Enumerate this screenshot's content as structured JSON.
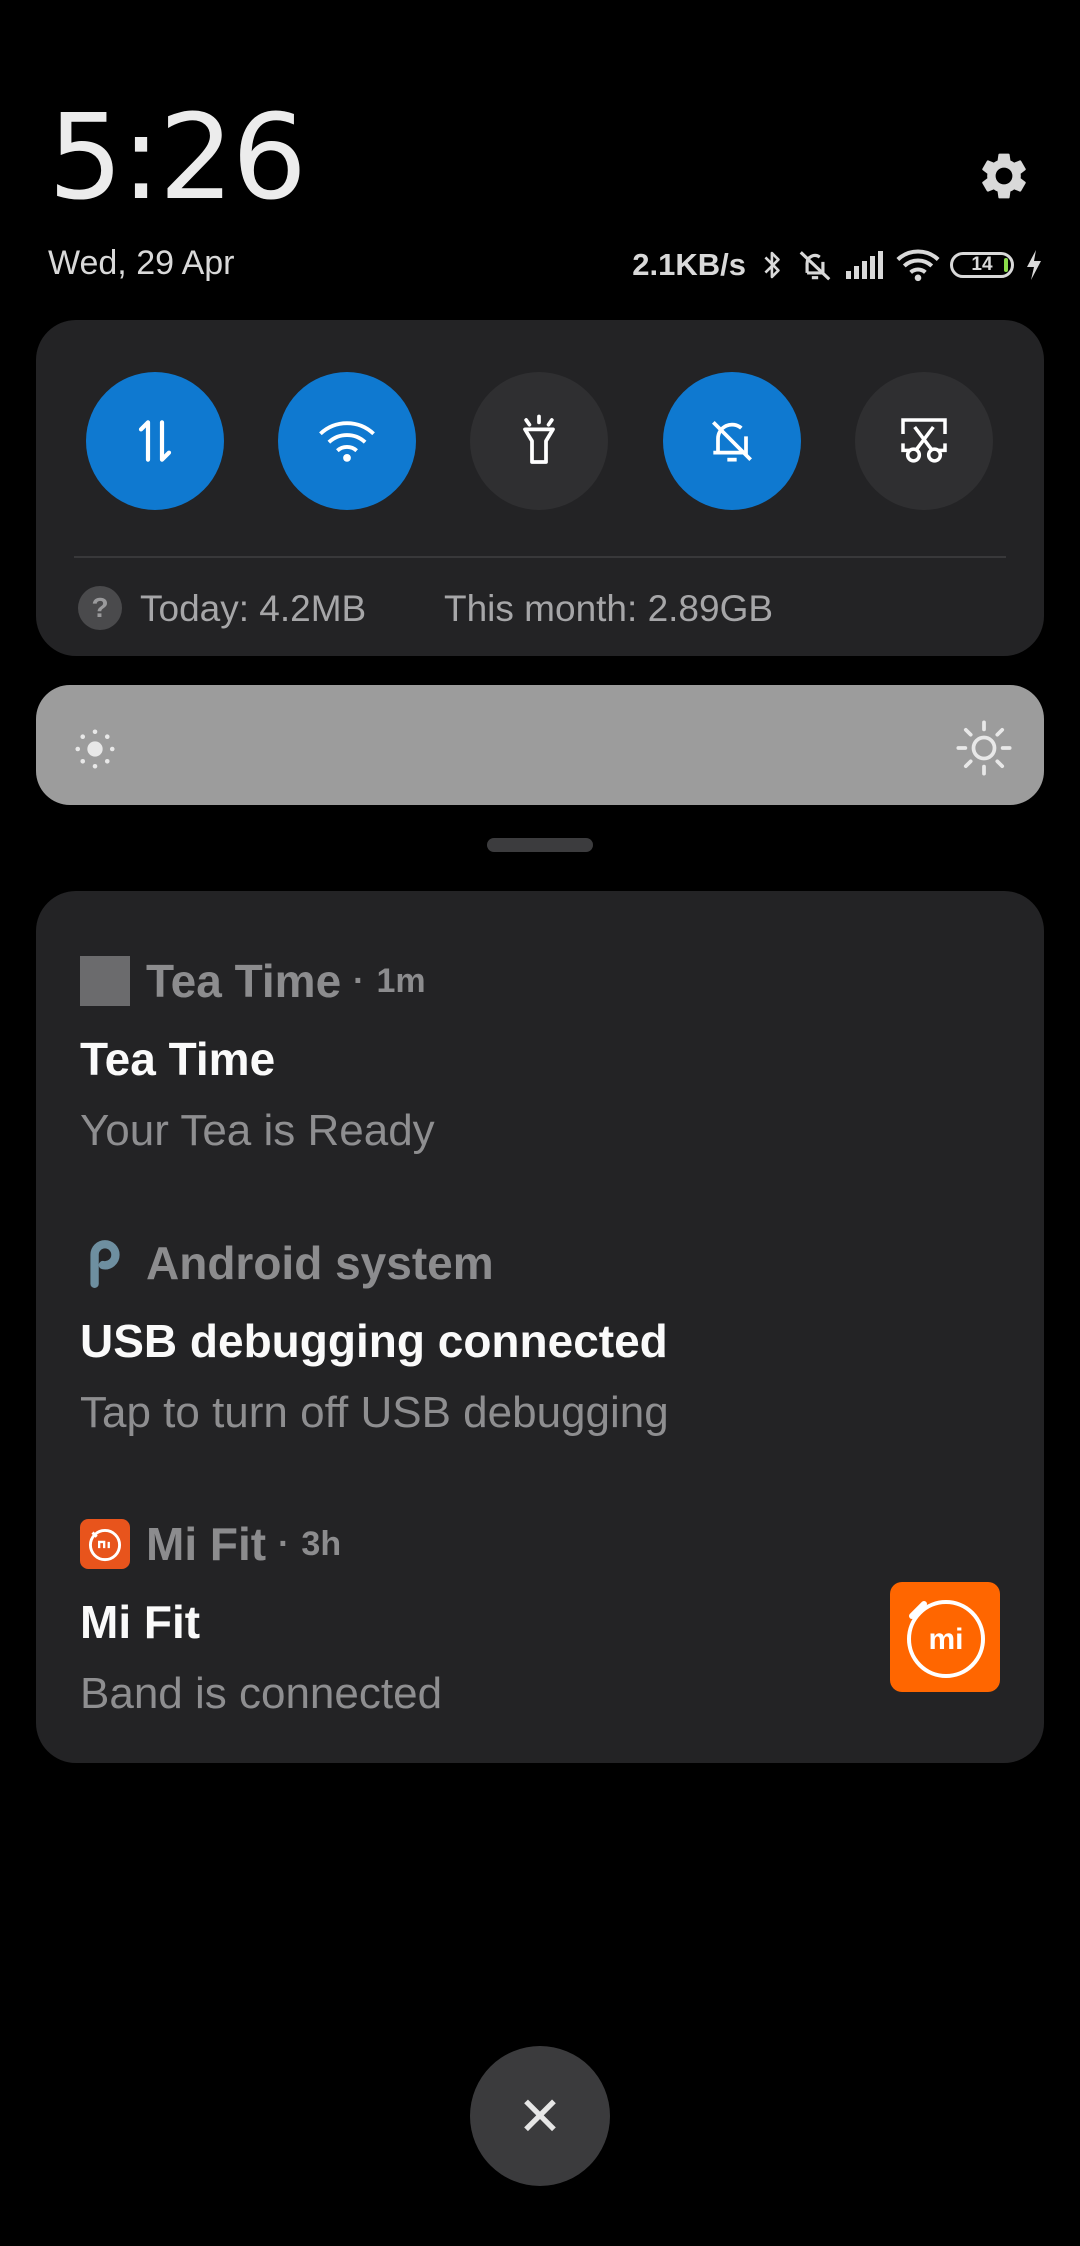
{
  "clock": {
    "time": "5:26",
    "date": "Wed, 29 Apr"
  },
  "status_bar": {
    "speed": "2.1KB/s",
    "battery_level": "14",
    "charging": true
  },
  "colors": {
    "accent": "#0f79d0",
    "panel": "#232325",
    "mi_orange": "#ff6600"
  },
  "quick_settings": {
    "tiles": [
      {
        "name": "mobile-data",
        "icon": "data-arrows-icon",
        "active": true
      },
      {
        "name": "wifi",
        "icon": "wifi-icon",
        "active": true
      },
      {
        "name": "flashlight",
        "icon": "flashlight-icon",
        "active": false
      },
      {
        "name": "silent",
        "icon": "bell-off-icon",
        "active": true
      },
      {
        "name": "screenshot",
        "icon": "screenshot-scissors-icon",
        "active": false
      }
    ],
    "usage_icon": "?",
    "today": "Today: 4.2MB",
    "month": "This month: 2.89GB"
  },
  "notifications": [
    {
      "app": "Tea Time",
      "time": "1m",
      "title": "Tea Time",
      "body": "Your Tea is Ready"
    },
    {
      "app": "Android system",
      "title": "USB debugging connected",
      "body": "Tap to turn off USB debugging"
    },
    {
      "app": "Mi Fit",
      "time": "3h",
      "title": "Mi Fit",
      "body": "Band is connected",
      "thumb_text": "mi"
    }
  ],
  "dot": "·",
  "close_symbol": "✕"
}
